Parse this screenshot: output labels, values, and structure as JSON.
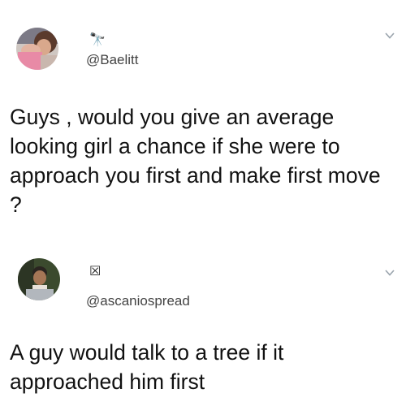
{
  "tweets": [
    {
      "display_name": "🔭",
      "handle": "@Baelitt",
      "text": "Guys , would you give an average looking girl a chance if she were to approach you first and make first move ?",
      "avatar_icon": "user-photo-avatar",
      "menu_icon": "chevron-down-icon"
    },
    {
      "display_name": "☒",
      "handle": "@ascaniospread",
      "text": "A guy would talk to a tree if it approached him first",
      "avatar_icon": "user-photo-avatar",
      "menu_icon": "chevron-down-icon"
    }
  ],
  "colors": {
    "background": "#ffffff",
    "text": "#111111",
    "handle": "#444444",
    "chevron": "#9aa4ad"
  }
}
